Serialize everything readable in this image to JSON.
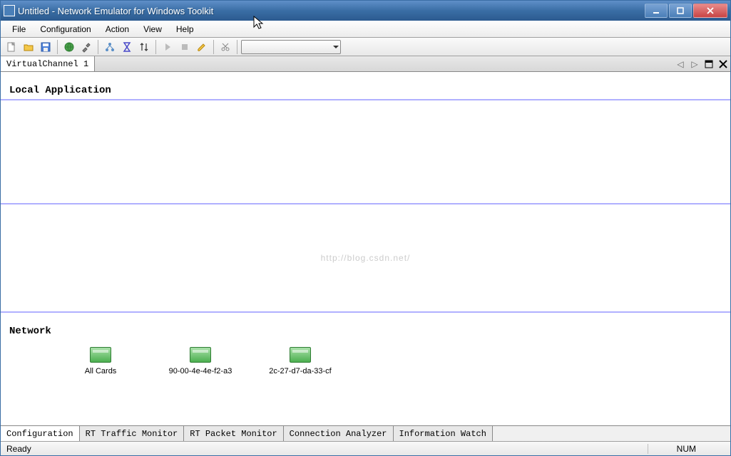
{
  "title": "Untitled - Network Emulator for Windows Toolkit",
  "menu": [
    "File",
    "Configuration",
    "Action",
    "View",
    "Help"
  ],
  "toolbar": {
    "icons": [
      "new",
      "open",
      "save",
      "globe",
      "tools",
      "network",
      "hourglass",
      "sort",
      "play",
      "stop",
      "clear",
      "scissors"
    ]
  },
  "tabs": {
    "items": [
      "VirtualChannel 1"
    ]
  },
  "sections": {
    "local": "Local Application",
    "network": "Network"
  },
  "watermark": "http://blog.csdn.net/",
  "nics": [
    {
      "label": "All Cards"
    },
    {
      "label": "90-00-4e-4e-f2-a3"
    },
    {
      "label": "2c-27-d7-da-33-cf"
    }
  ],
  "bottom_tabs": [
    "Configuration",
    "RT Traffic Monitor",
    "RT Packet Monitor",
    "Connection Analyzer",
    "Information Watch"
  ],
  "status": {
    "left": "Ready",
    "numlock": "NUM"
  }
}
